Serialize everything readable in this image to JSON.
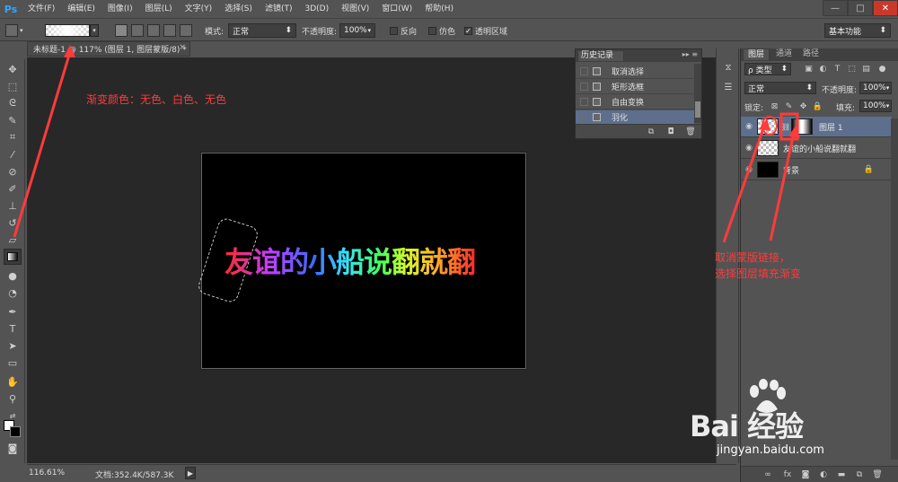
{
  "app": {
    "logo": "Ps"
  },
  "menu": [
    "文件(F)",
    "编辑(E)",
    "图像(I)",
    "图层(L)",
    "文字(Y)",
    "选择(S)",
    "滤镜(T)",
    "3D(D)",
    "视图(V)",
    "窗口(W)",
    "帮助(H)"
  ],
  "window_controls": {
    "minimize": "—",
    "maximize": "□",
    "close": "✕"
  },
  "options": {
    "mode_label": "模式:",
    "mode_value": "正常",
    "opacity_label": "不透明度:",
    "opacity_value": "100%",
    "reverse_label": "反向",
    "dither_label": "仿色",
    "transparency_label": "透明区域",
    "transparency_checked": "✓",
    "workspace_value": "基本功能"
  },
  "document": {
    "tab_title": "未标题-1 @ 117% (图层 1, 图层蒙版/8) *",
    "tab_close": "×",
    "canvas_text": "友谊的小船说翻就翻"
  },
  "status": {
    "zoom": "116.61%",
    "doc_size": "文档:352.4K/587.3K",
    "arrow": "▶"
  },
  "history": {
    "title": "历史记录",
    "menu": "▸▸ ≡",
    "items": [
      {
        "label": "取消选择"
      },
      {
        "label": "矩形选框"
      },
      {
        "label": "自由变换"
      },
      {
        "label": "羽化"
      }
    ]
  },
  "layers": {
    "tabs": [
      "图层",
      "通道",
      "路径"
    ],
    "kind_value": "ρ 类型",
    "blend_value": "正常",
    "opacity_label": "不透明度:",
    "opacity_value": "100%",
    "lock_label": "锁定:",
    "fill_label": "填充:",
    "fill_value": "100%",
    "items": [
      {
        "name": "图层 1",
        "eye": "◉"
      },
      {
        "name": "友谊的小船说翻就翻",
        "eye": "◉"
      },
      {
        "name": "背景",
        "eye": "◉",
        "lock": "🔒"
      }
    ]
  },
  "annotations": {
    "gradient_note": "渐变颜色：无色、白色、无色",
    "mask_note_line1": "取消蒙版链接，",
    "mask_note_line2": "选择图层填充渐变"
  },
  "watermark": {
    "main": "Bai  经验",
    "sub": "jingyan.baidu.com"
  },
  "colors": {
    "annotation": "#ff3b3b",
    "selection": "#5d6f8c",
    "ps_blue": "#31a8ff"
  },
  "icons": {
    "tools": [
      "move-icon",
      "marquee-icon",
      "lasso-icon",
      "quick-select-icon",
      "crop-icon",
      "eyedropper-icon",
      "healing-icon",
      "brush-icon",
      "stamp-icon",
      "history-brush-icon",
      "eraser-icon",
      "gradient-icon",
      "blur-icon",
      "dodge-icon",
      "pen-icon",
      "type-icon",
      "path-select-icon",
      "shape-icon",
      "hand-icon",
      "zoom-icon"
    ]
  }
}
